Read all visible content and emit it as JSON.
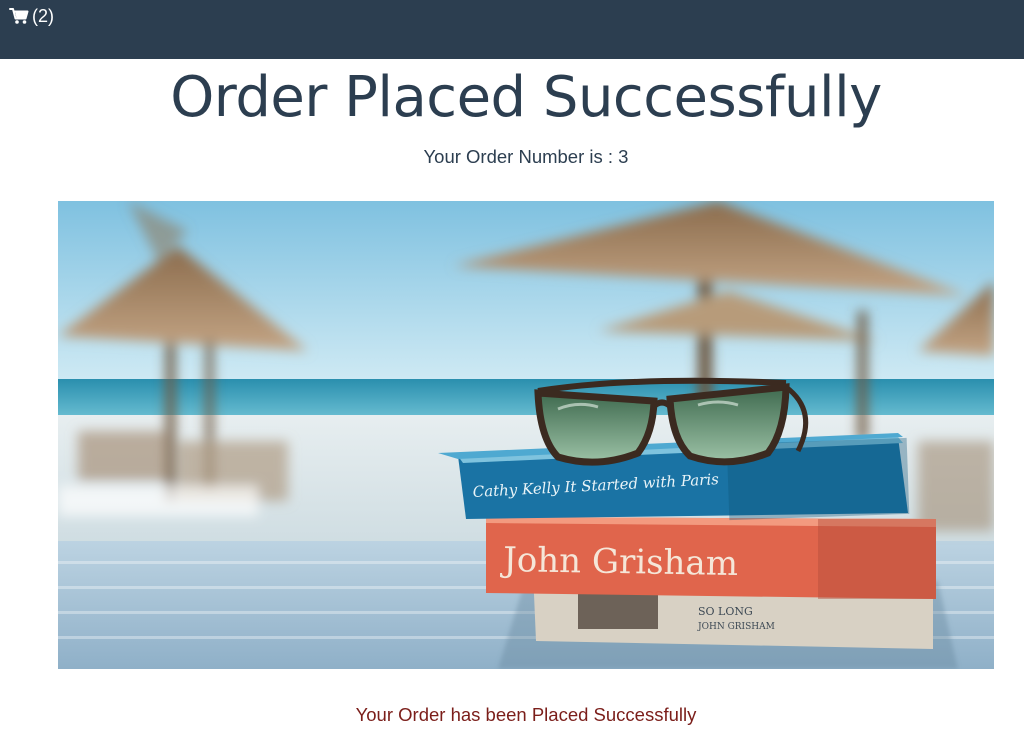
{
  "navbar": {
    "cart": {
      "icon": "shopping-cart-icon",
      "count_text": "(2)"
    }
  },
  "page": {
    "title": "Order Placed Successfully",
    "order_number_text": "Your Order Number is : 3",
    "success_message": "Your Order has been Placed Successfully"
  },
  "hero_image": {
    "book_top_text": "Cathy Kelly  It Started with Paris",
    "book_middle_text": "John Grisham"
  },
  "colors": {
    "navbar_bg": "#2c3e50",
    "title": "#2c3e50",
    "success_message": "#7b1e1a"
  }
}
